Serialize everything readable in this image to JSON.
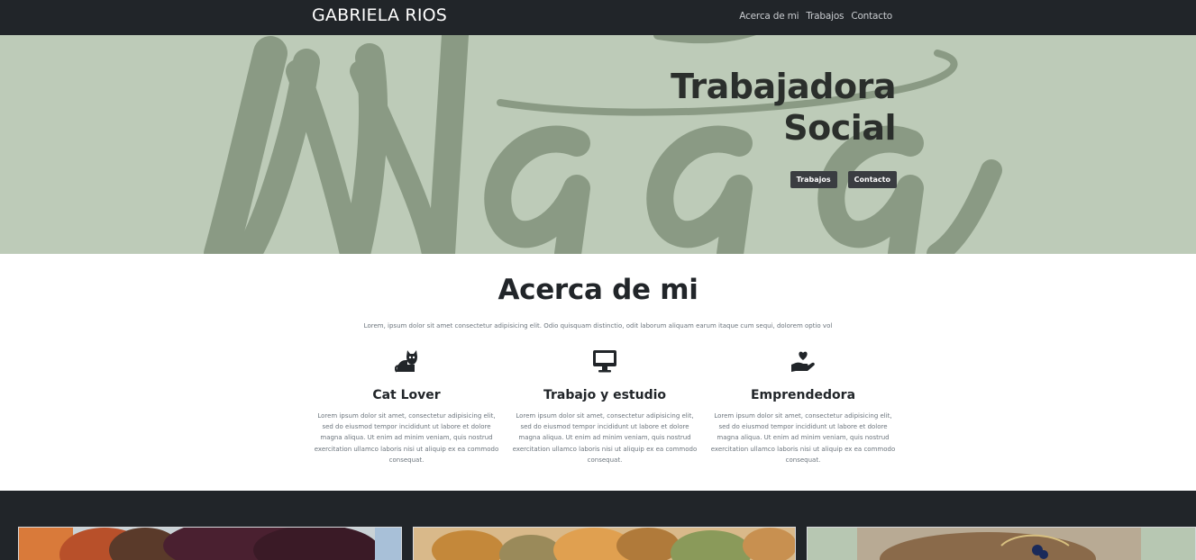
{
  "navbar": {
    "brand": "GABRIELA RIOS",
    "links": [
      "Acerca de mi",
      "Trabajos",
      "Contacto"
    ]
  },
  "hero": {
    "title_line1": "Trabajadora",
    "title_line2": "Social",
    "buttons": [
      "Trabajos",
      "Contacto"
    ],
    "background_color": "#bdcbb8"
  },
  "about": {
    "title": "Acerca de mi",
    "subtitle": "Lorem, ipsum dolor sit amet consectetur adipisicing elit. Odio quisquam distinctio, odit laborum aliquam earum itaque cum sequi, dolorem optio vol",
    "items": [
      {
        "icon": "cat-icon",
        "title": "Cat Lover",
        "text": "Lorem ipsum dolor sit amet, consectetur adipisicing elit, sed do eiusmod tempor incididunt ut labore et dolore magna aliqua. Ut enim ad minim veniam, quis nostrud exercitation ullamco laboris nisi ut aliquip ex ea commodo consequat."
      },
      {
        "icon": "desktop-icon",
        "title": "Trabajo y estudio",
        "text": "Lorem ipsum dolor sit amet, consectetur adipisicing elit, sed do eiusmod tempor incididunt ut labore et dolore magna aliqua. Ut enim ad minim veniam, quis nostrud exercitation ullamco laboris nisi ut aliquip ex ea commodo consequat."
      },
      {
        "icon": "hand-holding-heart-icon",
        "title": "Emprendedora",
        "text": "Lorem ipsum dolor sit amet, consectetur adipisicing elit, sed do eiusmod tempor incididunt ut labore et dolore magna aliqua. Ut enim ad minim veniam, quis nostrud exercitation ullamco laboris nisi ut aliquip ex ea commodo consequat."
      }
    ]
  },
  "colors": {
    "navbar": "#212529",
    "hero": "#bdcbb8",
    "hero_script": "#8a9a84",
    "button": "#3a3d41"
  }
}
